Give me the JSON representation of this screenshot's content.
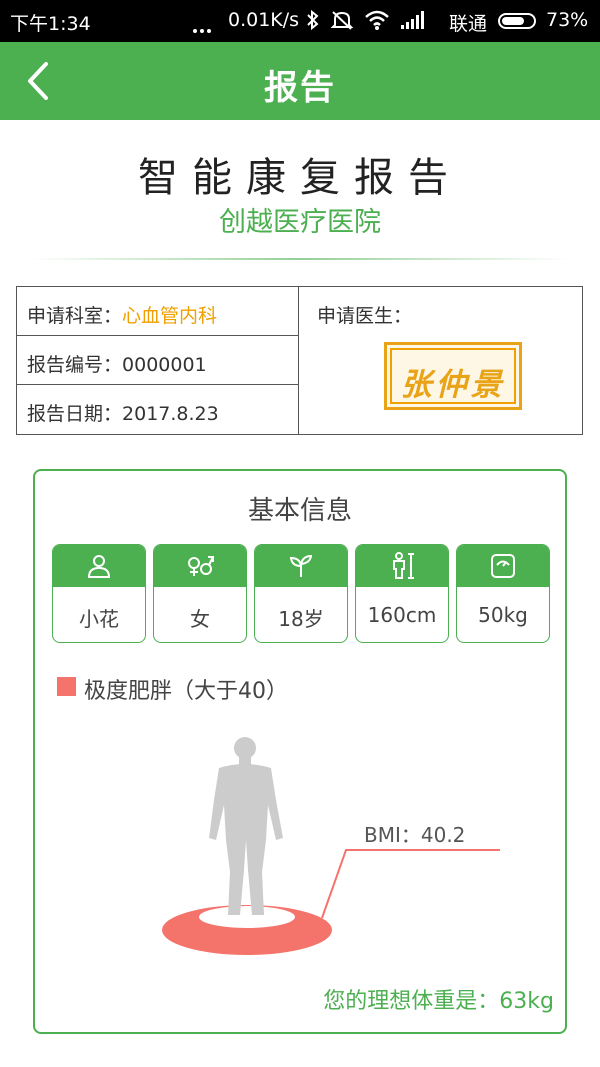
{
  "status_bar": {
    "time": "下午1:34",
    "speed": "0.01K/s",
    "carrier": "联通",
    "battery_percent": "73%",
    "battery_level": 0.73
  },
  "header": {
    "title": "报告",
    "back_icon": "chevron-left-icon"
  },
  "report": {
    "title": "智能康复报告",
    "hospital": "创越医疗医院"
  },
  "info": {
    "department_label": "申请科室：",
    "department_value": "心血管内科",
    "number_label": "报告编号：",
    "number_value": "0000001",
    "date_label": "报告日期：",
    "date_value": "2017.8.23",
    "doctor_label": "申请医生：",
    "doctor_seal": "张仲景"
  },
  "basic": {
    "title": "基本信息",
    "chips": [
      {
        "icon": "person-icon",
        "value": "小花"
      },
      {
        "icon": "gender-icon",
        "value": "女"
      },
      {
        "icon": "sprout-icon",
        "value": "18岁"
      },
      {
        "icon": "height-icon",
        "value": "160cm"
      },
      {
        "icon": "scale-icon",
        "value": "50kg"
      }
    ]
  },
  "bmi": {
    "category": "极度肥胖（大于40）",
    "label": "BMI：40.2",
    "ideal_weight": "您的理想体重是：63kg"
  },
  "colors": {
    "primary": "#4caf50",
    "accent_orange": "#f0a000",
    "bmi_red": "#f4736b"
  }
}
